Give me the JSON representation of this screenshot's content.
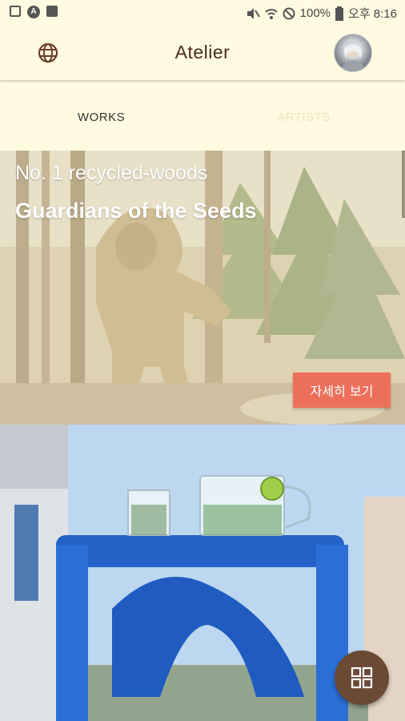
{
  "status_bar": {
    "battery": "100%",
    "time": "오후 8:16"
  },
  "app_bar": {
    "title": "Atelier"
  },
  "tabs": [
    {
      "label": "WORKS"
    },
    {
      "label": "ARTISTS"
    }
  ],
  "feature": {
    "subtitle": "No. 1 recycled-woods",
    "title": "Guardians of the Seeds",
    "button_label": "자세히 보기"
  },
  "colors": {
    "background": "#fffbe0",
    "accent": "#ec6f5b",
    "fab": "#6b4a35",
    "title": "#4a2a1e"
  },
  "icons": [
    "globe-icon",
    "avatar",
    "grid-icon",
    "image-icon",
    "a-circle-icon",
    "flipboard-icon",
    "mute-icon",
    "wifi-icon",
    "no-signal-icon",
    "battery-icon"
  ]
}
